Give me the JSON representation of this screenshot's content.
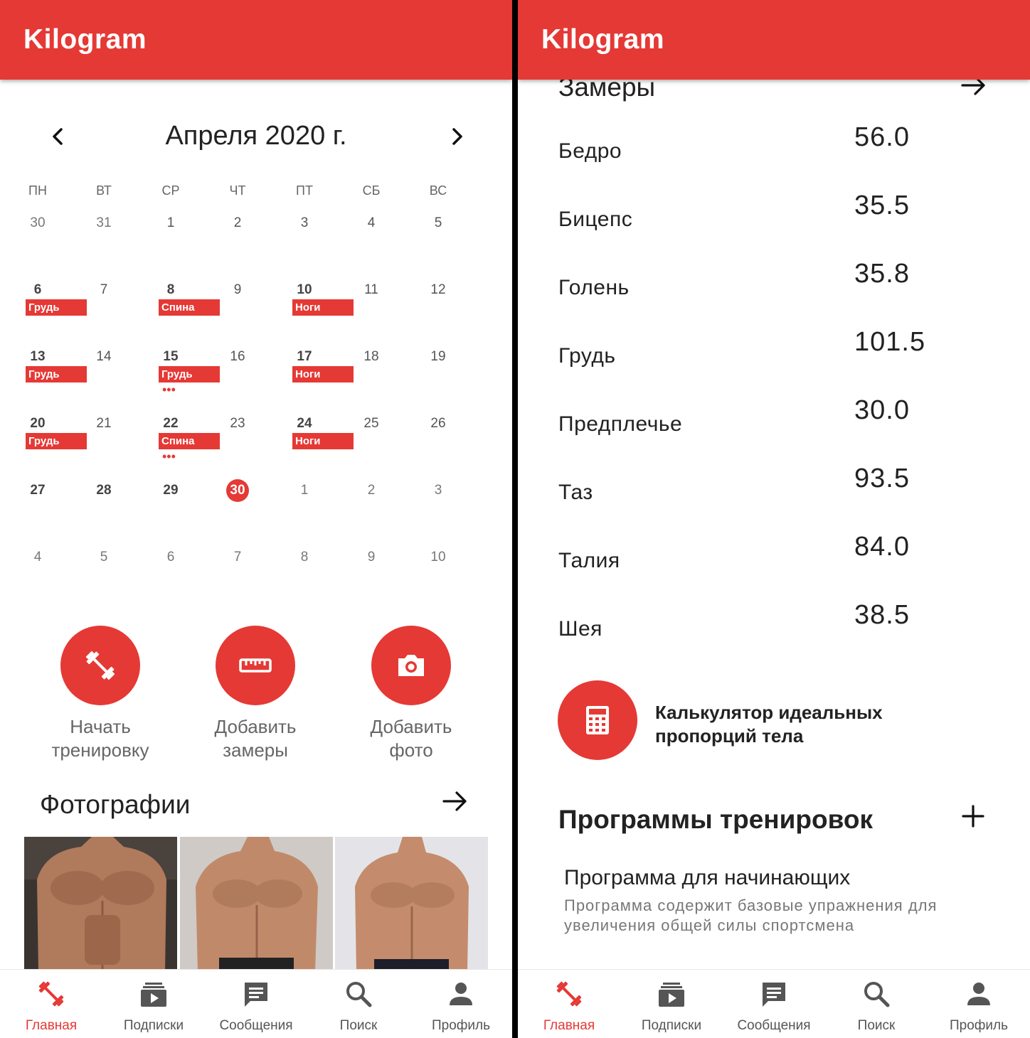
{
  "app": {
    "title": "Kilogram"
  },
  "calendar": {
    "month_title": "Апреля 2020 г.",
    "weekdays": [
      "ПН",
      "ВТ",
      "СР",
      "ЧТ",
      "ПТ",
      "СБ",
      "ВС"
    ],
    "weeks": [
      [
        "30",
        "31",
        "1",
        "2",
        "3",
        "4",
        "5"
      ],
      [
        "6",
        "7",
        "8",
        "9",
        "10",
        "11",
        "12"
      ],
      [
        "13",
        "14",
        "15",
        "16",
        "17",
        "18",
        "19"
      ],
      [
        "20",
        "21",
        "22",
        "23",
        "24",
        "25",
        "26"
      ],
      [
        "27",
        "28",
        "29",
        "30",
        "1",
        "2",
        "3"
      ],
      [
        "4",
        "5",
        "6",
        "7",
        "8",
        "9",
        "10"
      ]
    ],
    "today": "30",
    "events": [
      {
        "week": 1,
        "day": 0,
        "label": "Грудь"
      },
      {
        "week": 1,
        "day": 2,
        "label": "Спина"
      },
      {
        "week": 1,
        "day": 4,
        "label": "Ноги"
      },
      {
        "week": 2,
        "day": 0,
        "label": "Грудь"
      },
      {
        "week": 2,
        "day": 2,
        "label": "Грудь"
      },
      {
        "week": 2,
        "day": 4,
        "label": "Ноги"
      },
      {
        "week": 3,
        "day": 0,
        "label": "Грудь"
      },
      {
        "week": 3,
        "day": 2,
        "label": "Спина"
      },
      {
        "week": 3,
        "day": 4,
        "label": "Ноги"
      }
    ],
    "more_markers": [
      {
        "week": 2,
        "day": 2
      },
      {
        "week": 3,
        "day": 2
      }
    ],
    "more_marker_text": "•••"
  },
  "actions": [
    {
      "label_line1": "Начать",
      "label_line2": "тренировку",
      "icon": "dumbbell-icon"
    },
    {
      "label_line1": "Добавить",
      "label_line2": "замеры",
      "icon": "ruler-icon"
    },
    {
      "label_line1": "Добавить",
      "label_line2": "фото",
      "icon": "camera-icon"
    }
  ],
  "photos_section": {
    "title": "Фотографии"
  },
  "measurements": {
    "title": "Замеры",
    "items": [
      {
        "label": "Бедро",
        "value": "56.0"
      },
      {
        "label": "Бицепс",
        "value": "35.5"
      },
      {
        "label": "Голень",
        "value": "35.8"
      },
      {
        "label": "Грудь",
        "value": "101.5"
      },
      {
        "label": "Предплечье",
        "value": "30.0"
      },
      {
        "label": "Таз",
        "value": "93.5"
      },
      {
        "label": "Талия",
        "value": "84.0"
      },
      {
        "label": "Шея",
        "value": "38.5"
      }
    ]
  },
  "calculator": {
    "label": "Калькулятор идеальных пропорций тела",
    "icon": "calculator-icon"
  },
  "programs": {
    "title": "Программы тренировок",
    "items": [
      {
        "title": "Программа для начинающих",
        "description": "Программа содержит базовые упражнения для увеличения общей силы спортсмена"
      }
    ]
  },
  "bottom_nav": [
    {
      "label": "Главная",
      "icon": "dumbbell-icon",
      "active": true
    },
    {
      "label": "Подписки",
      "icon": "subscriptions-icon",
      "active": false
    },
    {
      "label": "Сообщения",
      "icon": "message-icon",
      "active": false
    },
    {
      "label": "Поиск",
      "icon": "search-icon",
      "active": false
    },
    {
      "label": "Профиль",
      "icon": "person-icon",
      "active": false
    }
  ],
  "colors": {
    "accent": "#e53935",
    "divider": "#000000"
  }
}
